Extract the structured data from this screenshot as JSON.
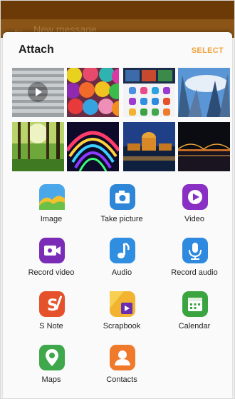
{
  "background_screen": {
    "title": "New message",
    "back_icon": "back-arrow-icon"
  },
  "sheet": {
    "title": "Attach",
    "select_label": "SELECT"
  },
  "thumbnails": [
    {
      "icon": "video-thumbnail",
      "has_play": true
    },
    {
      "icon": "yarn-balls-photo"
    },
    {
      "icon": "screenshot-photo"
    },
    {
      "icon": "skyscrapers-photo"
    },
    {
      "icon": "forest-photo"
    },
    {
      "icon": "colorful-tunnel-photo"
    },
    {
      "icon": "palace-night-photo"
    },
    {
      "icon": "city-night-photo"
    }
  ],
  "apps": [
    {
      "label": "Image",
      "icon": "image-icon",
      "color": "#3ea0e8"
    },
    {
      "label": "Take picture",
      "icon": "camera-icon",
      "color": "#2d86d8"
    },
    {
      "label": "Video",
      "icon": "video-play-icon",
      "color": "#8a2fc4"
    },
    {
      "label": "Record video",
      "icon": "record-video-icon",
      "color": "#7a2cb6"
    },
    {
      "label": "Audio",
      "icon": "music-note-icon",
      "color": "#2f8ee0"
    },
    {
      "label": "Record audio",
      "icon": "microphone-icon",
      "color": "#2e8adf"
    },
    {
      "label": "S Note",
      "icon": "s-note-icon",
      "color": "#e5512b"
    },
    {
      "label": "Scrapbook",
      "icon": "scrapbook-icon",
      "color": "#f2b430"
    },
    {
      "label": "Calendar",
      "icon": "calendar-icon",
      "color": "#3aa441"
    },
    {
      "label": "Maps",
      "icon": "map-pin-icon",
      "color": "#3ea84a"
    },
    {
      "label": "Contacts",
      "icon": "contact-icon",
      "color": "#ef7a2c"
    }
  ]
}
